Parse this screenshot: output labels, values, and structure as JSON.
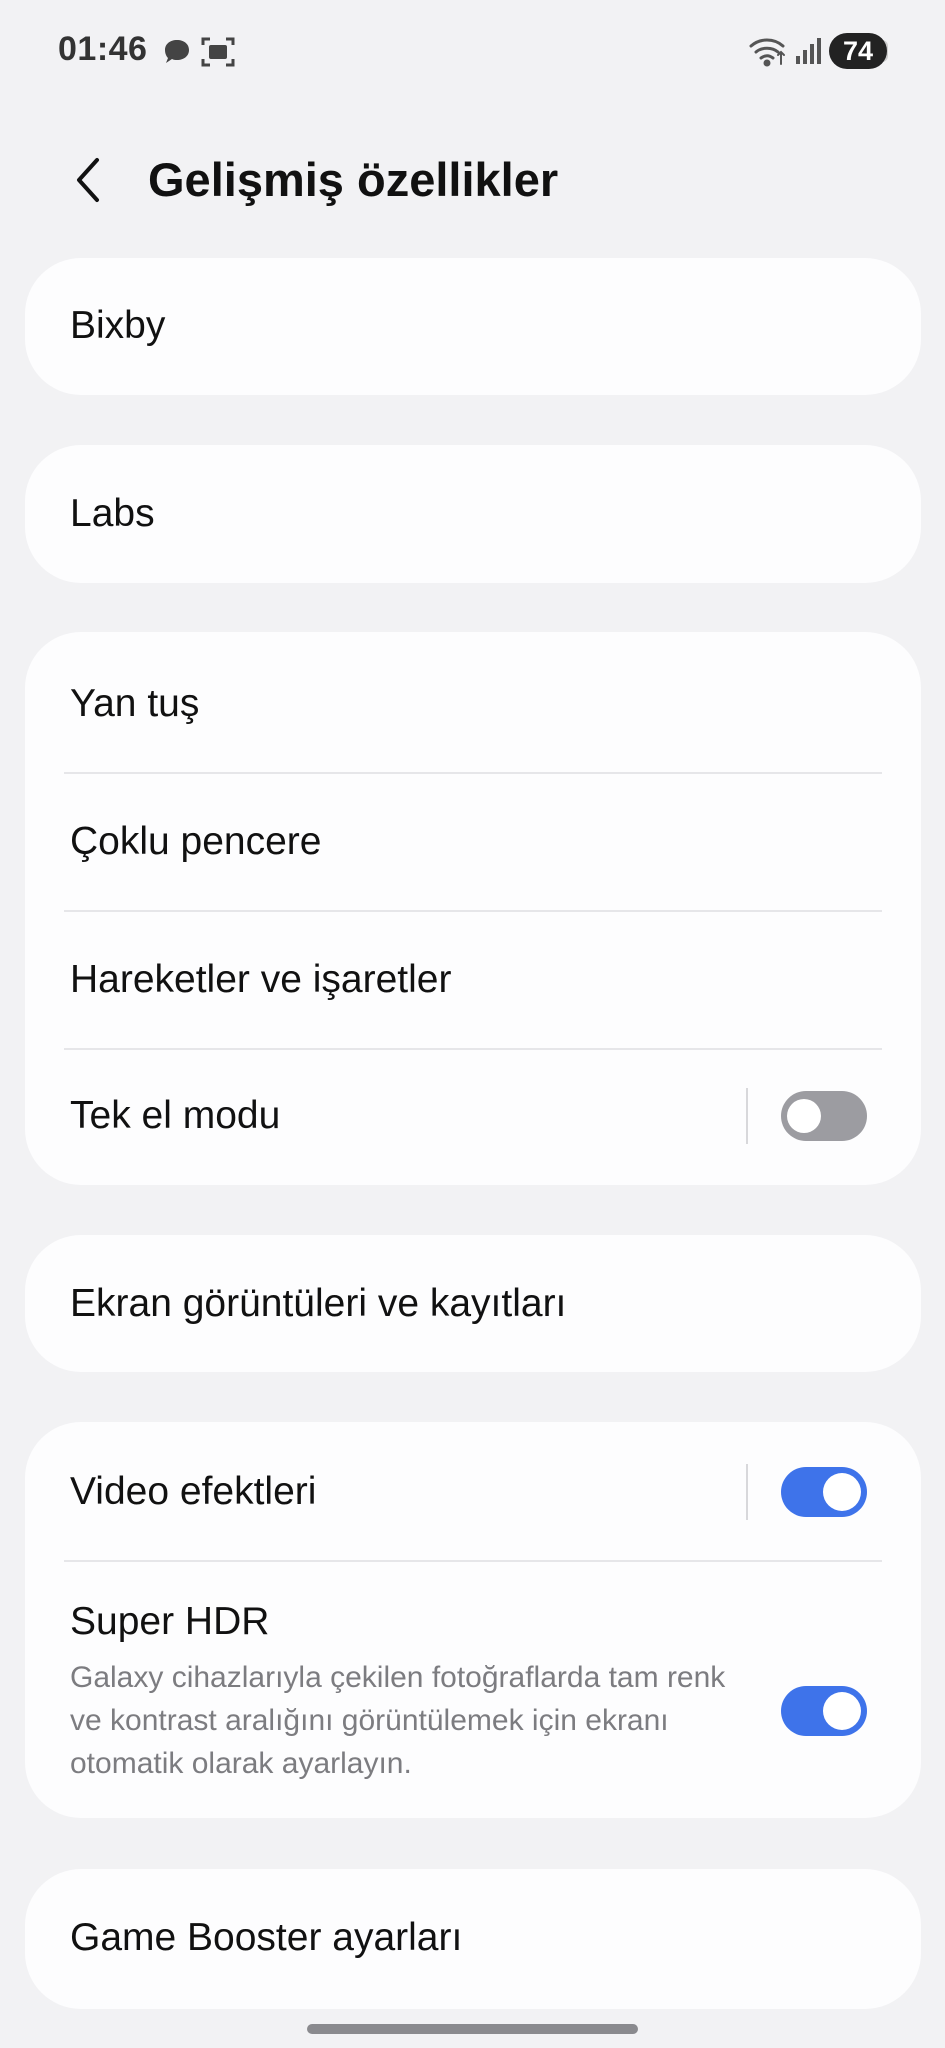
{
  "status_bar": {
    "time": "01:46",
    "battery": "74",
    "icons": [
      "message-icon",
      "screenshot-icon",
      "wifi-icon",
      "signal-icon",
      "battery-icon"
    ]
  },
  "header": {
    "back_icon": "chevron-left-icon",
    "title": "Gelişmiş özellikler"
  },
  "items": {
    "bixby": "Bixby",
    "labs": "Labs",
    "side_key": "Yan tuş",
    "multi_window": "Çoklu pencere",
    "motions": "Hareketler ve işaretler",
    "one_hand": "Tek el modu",
    "screenshots": "Ekran görüntüleri ve kayıtları",
    "video_effects": "Video efektleri",
    "super_hdr": "Super HDR",
    "super_hdr_desc": "Galaxy cihazlarıyla çekilen fotoğraflarda tam renk ve kontrast aralığını görüntülemek için ekranı otomatik olarak ayarlayın.",
    "game_booster": "Game Booster ayarları"
  },
  "toggles": {
    "one_hand": false,
    "video_effects": true,
    "super_hdr": true
  },
  "colors": {
    "background": "#f2f2f4",
    "card": "#fdfdfe",
    "toggle_on": "#3e73ea",
    "toggle_off": "#9c9ca1"
  }
}
